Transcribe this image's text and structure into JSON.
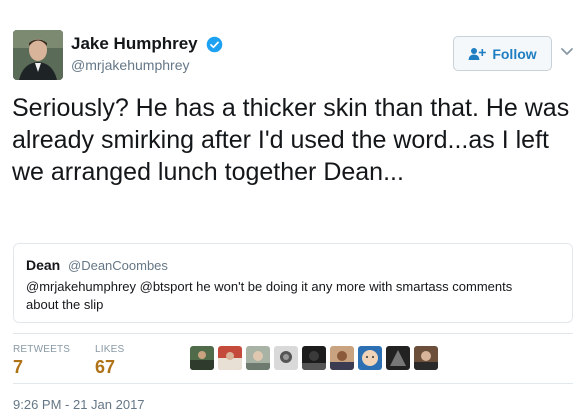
{
  "author": {
    "name": "Jake Humphrey",
    "handle": "@mrjakehumphrey",
    "verified": true
  },
  "follow_button": {
    "label": "Follow",
    "icon": "add-user-icon"
  },
  "tweet": {
    "text": "Seriously? He has a thicker skin than that. He was already smirking after I'd used the word...as I left we arranged lunch together Dean..."
  },
  "quoted_tweet": {
    "name": "Dean",
    "handle": "@DeanCoombes",
    "text": "@mrjakehumphrey @btsport he won't be doing it any more with smartass comments about the slip"
  },
  "stats": {
    "retweets_label": "RETWEETS",
    "retweets_count": "7",
    "likes_label": "LIKES",
    "likes_count": "67"
  },
  "timestamp": "9:26 PM - 21 Jan 2017",
  "colors": {
    "link": "#1f7ec2",
    "verified": "#1da1f2",
    "stat_value": "#b07216",
    "muted": "#657786"
  }
}
